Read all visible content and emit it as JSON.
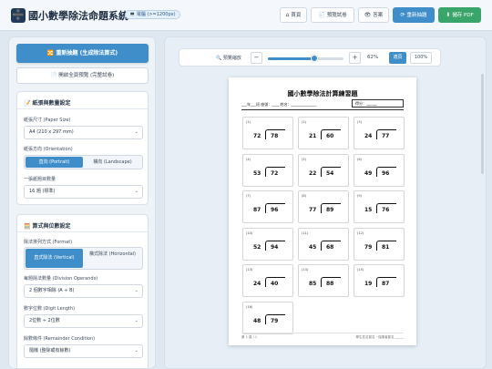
{
  "header": {
    "logo_glyph": "➗",
    "title": "國小數學除法命題系統",
    "badge": "💻 電腦 (>=1200px)",
    "buttons": [
      {
        "icon": "⌂",
        "label": "首頁"
      },
      {
        "icon": "📄",
        "label": "預覽試卷"
      },
      {
        "icon": "👁",
        "label": "答案"
      },
      {
        "icon": "⟳",
        "label": "重新抽題"
      },
      {
        "icon": "⬇",
        "label": "儲存 PDF"
      }
    ]
  },
  "sidebar": {
    "primary_button": "🔀 重新抽題 (生成除法算式)",
    "secondary_button": "📄 開啟全頁預覽 (完整試卷)",
    "paper_card": {
      "title": "📝 紙張與數量設定",
      "paper_size_label": "紙張尺寸 (Paper Size)",
      "paper_size_value": "A4 (210 x 297 mm)",
      "orientation_label": "紙張方向 (Orientation)",
      "orientation_options": [
        "直向 (Portrait)",
        "橫向 (Landscape)"
      ],
      "count_label": "一張紙題目數量",
      "count_value": "16 題 (標準)"
    },
    "format_card": {
      "title": "🧮 算式與位數設定",
      "format_label": "除法排列方式 (Format)",
      "format_options": [
        "直式除法 (Vertical)",
        "橫式除法 (Horizontal)"
      ],
      "operands_label": "每題除法數量 (Division Operands)",
      "operands_value": "2 個數字相除 (A ÷ B)",
      "digits_label": "數字位數 (Digit Length)",
      "digits_value": "2位數 ÷ 2位數",
      "remainder_label": "餘數條件 (Remainder Condition)",
      "remainder_value": "隨機 (整除或有餘數)"
    }
  },
  "zoom": {
    "label": "🔍 預覽縮放",
    "minus": "−",
    "plus": "+",
    "value_text": "62%",
    "value": 62,
    "fit_label": "適頁",
    "full_label": "100%"
  },
  "paper": {
    "title": "國小數學除法計算練習題",
    "info_line": "___年___班 座號：____ 姓名：______________",
    "score_label": "得分：______",
    "footer_left": "第 1 頁 / 1",
    "footer_right": "學生姓名簽名・保護者簽名______",
    "questions": [
      {
        "n": "(1)",
        "divisor": "72",
        "dividend": "78"
      },
      {
        "n": "(2)",
        "divisor": "21",
        "dividend": "60"
      },
      {
        "n": "(3)",
        "divisor": "24",
        "dividend": "77"
      },
      {
        "n": "(4)",
        "divisor": "53",
        "dividend": "72"
      },
      {
        "n": "(5)",
        "divisor": "22",
        "dividend": "54"
      },
      {
        "n": "(6)",
        "divisor": "49",
        "dividend": "96"
      },
      {
        "n": "(7)",
        "divisor": "87",
        "dividend": "96"
      },
      {
        "n": "(8)",
        "divisor": "77",
        "dividend": "89"
      },
      {
        "n": "(9)",
        "divisor": "15",
        "dividend": "76"
      },
      {
        "n": "(10)",
        "divisor": "52",
        "dividend": "94"
      },
      {
        "n": "(11)",
        "divisor": "45",
        "dividend": "68"
      },
      {
        "n": "(12)",
        "divisor": "79",
        "dividend": "81"
      },
      {
        "n": "(13)",
        "divisor": "24",
        "dividend": "40"
      },
      {
        "n": "(14)",
        "divisor": "85",
        "dividend": "88"
      },
      {
        "n": "(15)",
        "divisor": "19",
        "dividend": "87"
      },
      {
        "n": "(16)",
        "divisor": "48",
        "dividend": "79"
      }
    ]
  },
  "colors": {
    "accent": "#3f8ec9",
    "save": "#3aa56a",
    "background": "#dfe8f1"
  }
}
